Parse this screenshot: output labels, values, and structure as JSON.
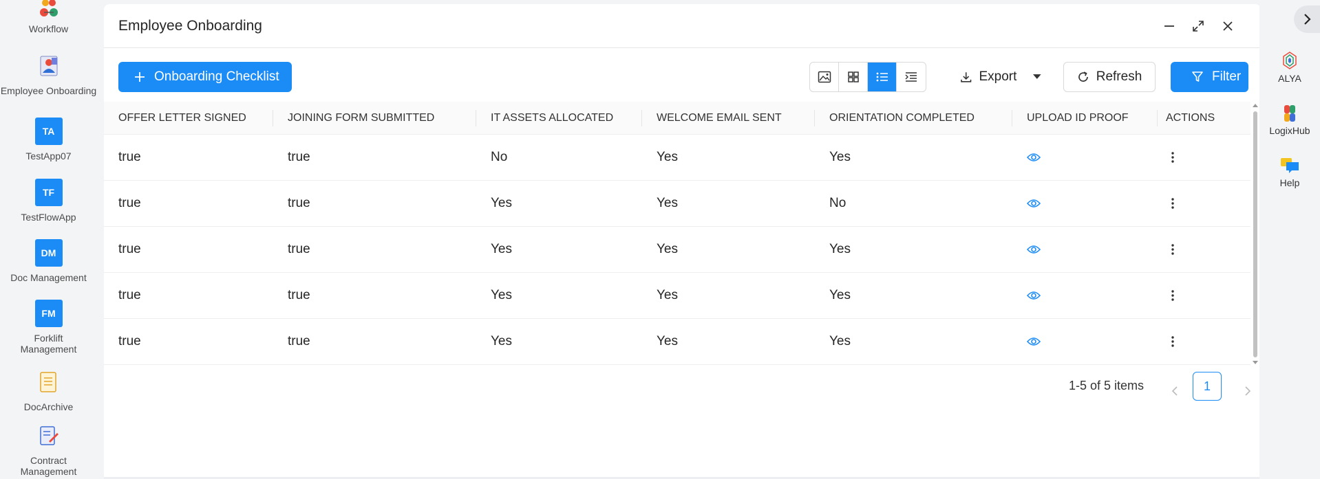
{
  "sidebar": {
    "apps": [
      {
        "label": "Workflow",
        "icon": "workflow-icon"
      },
      {
        "label": "Employee Onboarding",
        "icon": "employee-onboarding-icon"
      },
      {
        "label": "TestApp07",
        "badge": "TA"
      },
      {
        "label": "TestFlowApp",
        "badge": "TF"
      },
      {
        "label": "Doc Management",
        "badge": "DM"
      },
      {
        "label": "Forklift Management",
        "badge": "FM"
      },
      {
        "label": "DocArchive",
        "icon": "document-icon"
      },
      {
        "label": "Contract Management",
        "icon": "contract-icon"
      }
    ]
  },
  "right_rail": {
    "items": [
      {
        "label": "ALYA",
        "icon": "alya-icon"
      },
      {
        "label": "LogixHub",
        "icon": "logixhub-icon"
      },
      {
        "label": "Help",
        "icon": "help-chat-icon"
      }
    ]
  },
  "panel": {
    "title": "Employee Onboarding"
  },
  "toolbar": {
    "add_label": "Onboarding Checklist",
    "export_label": "Export",
    "refresh_label": "Refresh",
    "filter_label": "Filter",
    "active_view": "list",
    "accent_color": "#1b8cf5"
  },
  "table": {
    "columns": [
      "OFFER LETTER SIGNED",
      "JOINING FORM SUBMITTED",
      "IT ASSETS ALLOCATED",
      "WELCOME EMAIL SENT",
      "ORIENTATION COMPLETED",
      "UPLOAD ID PROOF",
      "ACTIONS"
    ],
    "rows": [
      [
        "true",
        "true",
        "No",
        "Yes",
        "Yes"
      ],
      [
        "true",
        "true",
        "Yes",
        "Yes",
        "No"
      ],
      [
        "true",
        "true",
        "Yes",
        "Yes",
        "Yes"
      ],
      [
        "true",
        "true",
        "Yes",
        "Yes",
        "Yes"
      ],
      [
        "true",
        "true",
        "Yes",
        "Yes",
        "Yes"
      ]
    ]
  },
  "pagination": {
    "info": "1-5 of 5 items",
    "current_page": "1"
  }
}
